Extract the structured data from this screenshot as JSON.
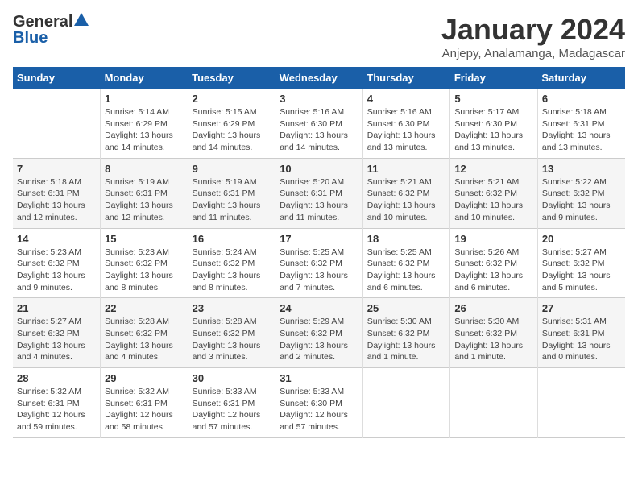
{
  "header": {
    "logo_general": "General",
    "logo_blue": "Blue",
    "title": "January 2024",
    "subtitle": "Anjepy, Analamanga, Madagascar"
  },
  "calendar": {
    "days_of_week": [
      "Sunday",
      "Monday",
      "Tuesday",
      "Wednesday",
      "Thursday",
      "Friday",
      "Saturday"
    ],
    "weeks": [
      [
        {
          "day": "",
          "detail": ""
        },
        {
          "day": "1",
          "detail": "Sunrise: 5:14 AM\nSunset: 6:29 PM\nDaylight: 13 hours\nand 14 minutes."
        },
        {
          "day": "2",
          "detail": "Sunrise: 5:15 AM\nSunset: 6:29 PM\nDaylight: 13 hours\nand 14 minutes."
        },
        {
          "day": "3",
          "detail": "Sunrise: 5:16 AM\nSunset: 6:30 PM\nDaylight: 13 hours\nand 14 minutes."
        },
        {
          "day": "4",
          "detail": "Sunrise: 5:16 AM\nSunset: 6:30 PM\nDaylight: 13 hours\nand 13 minutes."
        },
        {
          "day": "5",
          "detail": "Sunrise: 5:17 AM\nSunset: 6:30 PM\nDaylight: 13 hours\nand 13 minutes."
        },
        {
          "day": "6",
          "detail": "Sunrise: 5:18 AM\nSunset: 6:31 PM\nDaylight: 13 hours\nand 13 minutes."
        }
      ],
      [
        {
          "day": "7",
          "detail": "Sunrise: 5:18 AM\nSunset: 6:31 PM\nDaylight: 13 hours\nand 12 minutes."
        },
        {
          "day": "8",
          "detail": "Sunrise: 5:19 AM\nSunset: 6:31 PM\nDaylight: 13 hours\nand 12 minutes."
        },
        {
          "day": "9",
          "detail": "Sunrise: 5:19 AM\nSunset: 6:31 PM\nDaylight: 13 hours\nand 11 minutes."
        },
        {
          "day": "10",
          "detail": "Sunrise: 5:20 AM\nSunset: 6:31 PM\nDaylight: 13 hours\nand 11 minutes."
        },
        {
          "day": "11",
          "detail": "Sunrise: 5:21 AM\nSunset: 6:32 PM\nDaylight: 13 hours\nand 10 minutes."
        },
        {
          "day": "12",
          "detail": "Sunrise: 5:21 AM\nSunset: 6:32 PM\nDaylight: 13 hours\nand 10 minutes."
        },
        {
          "day": "13",
          "detail": "Sunrise: 5:22 AM\nSunset: 6:32 PM\nDaylight: 13 hours\nand 9 minutes."
        }
      ],
      [
        {
          "day": "14",
          "detail": "Sunrise: 5:23 AM\nSunset: 6:32 PM\nDaylight: 13 hours\nand 9 minutes."
        },
        {
          "day": "15",
          "detail": "Sunrise: 5:23 AM\nSunset: 6:32 PM\nDaylight: 13 hours\nand 8 minutes."
        },
        {
          "day": "16",
          "detail": "Sunrise: 5:24 AM\nSunset: 6:32 PM\nDaylight: 13 hours\nand 8 minutes."
        },
        {
          "day": "17",
          "detail": "Sunrise: 5:25 AM\nSunset: 6:32 PM\nDaylight: 13 hours\nand 7 minutes."
        },
        {
          "day": "18",
          "detail": "Sunrise: 5:25 AM\nSunset: 6:32 PM\nDaylight: 13 hours\nand 6 minutes."
        },
        {
          "day": "19",
          "detail": "Sunrise: 5:26 AM\nSunset: 6:32 PM\nDaylight: 13 hours\nand 6 minutes."
        },
        {
          "day": "20",
          "detail": "Sunrise: 5:27 AM\nSunset: 6:32 PM\nDaylight: 13 hours\nand 5 minutes."
        }
      ],
      [
        {
          "day": "21",
          "detail": "Sunrise: 5:27 AM\nSunset: 6:32 PM\nDaylight: 13 hours\nand 4 minutes."
        },
        {
          "day": "22",
          "detail": "Sunrise: 5:28 AM\nSunset: 6:32 PM\nDaylight: 13 hours\nand 4 minutes."
        },
        {
          "day": "23",
          "detail": "Sunrise: 5:28 AM\nSunset: 6:32 PM\nDaylight: 13 hours\nand 3 minutes."
        },
        {
          "day": "24",
          "detail": "Sunrise: 5:29 AM\nSunset: 6:32 PM\nDaylight: 13 hours\nand 2 minutes."
        },
        {
          "day": "25",
          "detail": "Sunrise: 5:30 AM\nSunset: 6:32 PM\nDaylight: 13 hours\nand 1 minute."
        },
        {
          "day": "26",
          "detail": "Sunrise: 5:30 AM\nSunset: 6:32 PM\nDaylight: 13 hours\nand 1 minute."
        },
        {
          "day": "27",
          "detail": "Sunrise: 5:31 AM\nSunset: 6:31 PM\nDaylight: 13 hours\nand 0 minutes."
        }
      ],
      [
        {
          "day": "28",
          "detail": "Sunrise: 5:32 AM\nSunset: 6:31 PM\nDaylight: 12 hours\nand 59 minutes."
        },
        {
          "day": "29",
          "detail": "Sunrise: 5:32 AM\nSunset: 6:31 PM\nDaylight: 12 hours\nand 58 minutes."
        },
        {
          "day": "30",
          "detail": "Sunrise: 5:33 AM\nSunset: 6:31 PM\nDaylight: 12 hours\nand 57 minutes."
        },
        {
          "day": "31",
          "detail": "Sunrise: 5:33 AM\nSunset: 6:30 PM\nDaylight: 12 hours\nand 57 minutes."
        },
        {
          "day": "",
          "detail": ""
        },
        {
          "day": "",
          "detail": ""
        },
        {
          "day": "",
          "detail": ""
        }
      ]
    ]
  }
}
